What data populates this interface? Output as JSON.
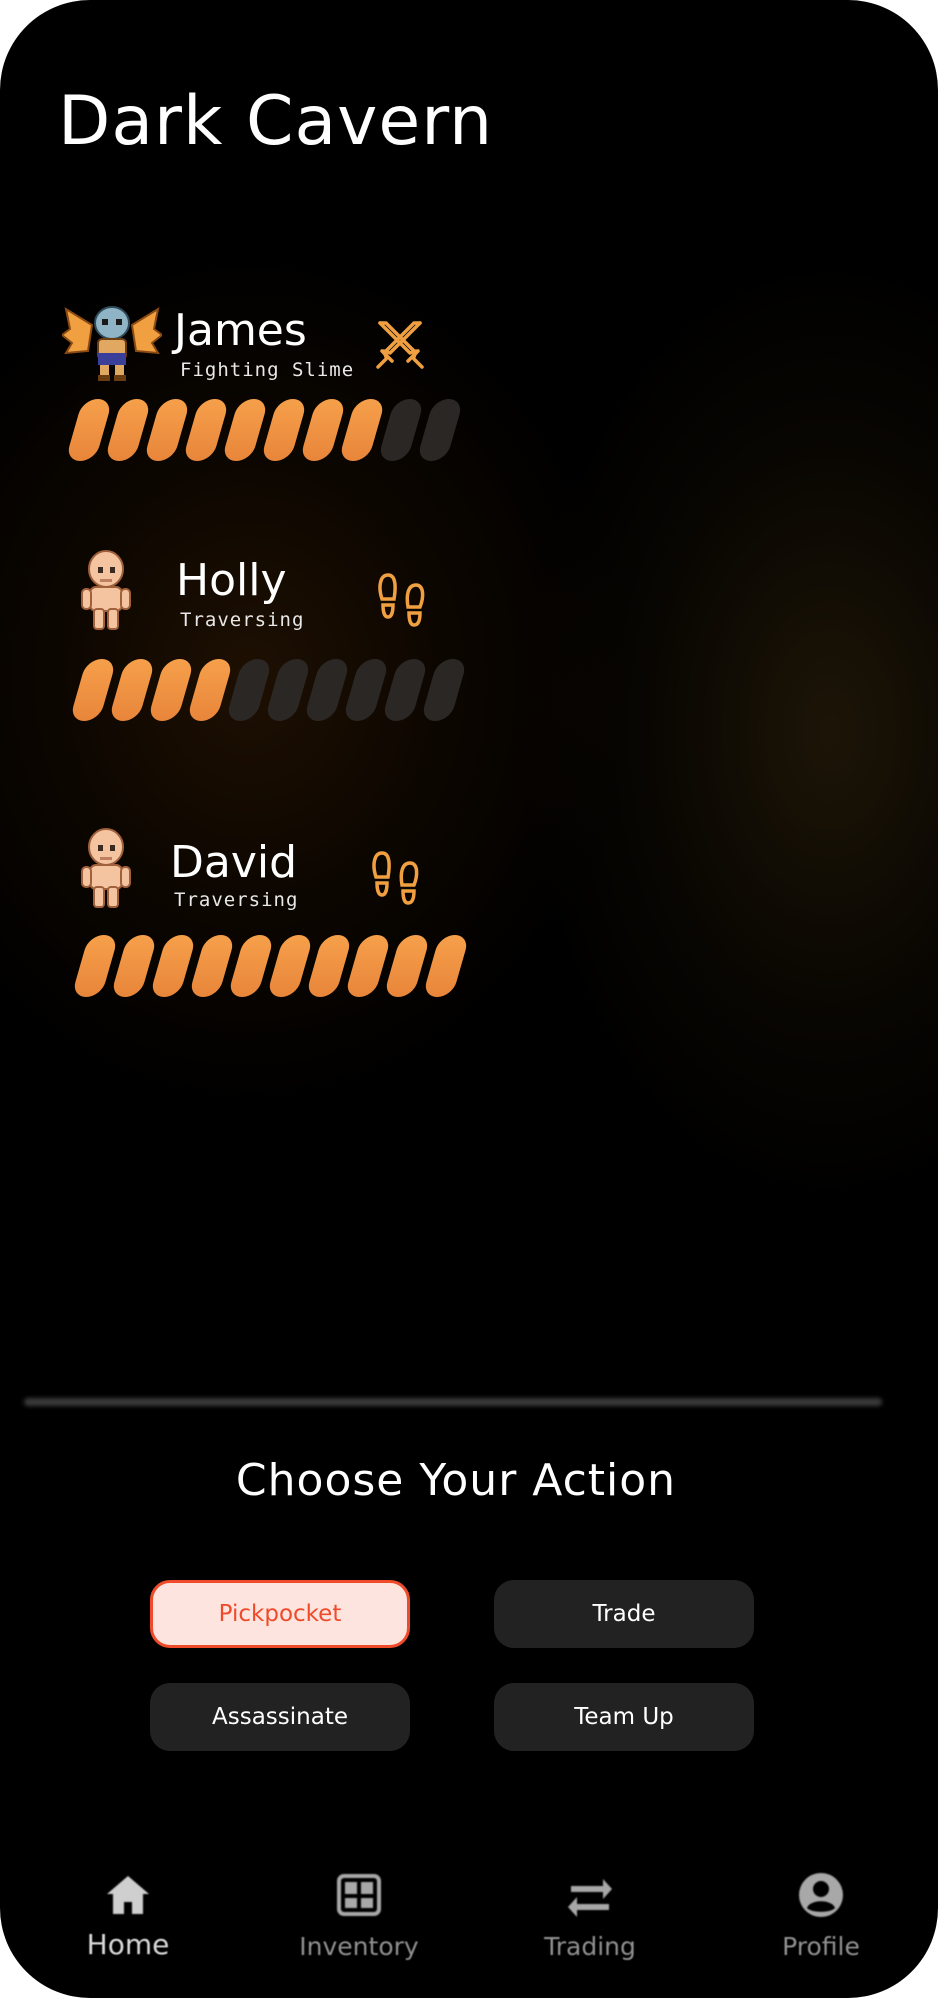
{
  "title": "Dark Cavern",
  "players": [
    {
      "name": "James",
      "status": "Fighting Slime",
      "action_icon": "crossed-swords-icon",
      "avatar": "winged-knight-avatar",
      "progress": {
        "filled": 8,
        "total": 10
      }
    },
    {
      "name": "Holly",
      "status": "Traversing",
      "action_icon": "footprints-icon",
      "avatar": "bald-human-avatar",
      "progress": {
        "filled": 4,
        "total": 10
      }
    },
    {
      "name": "David",
      "status": "Traversing",
      "action_icon": "footprints-icon",
      "avatar": "bald-human-avatar",
      "progress": {
        "filled": 10,
        "total": 10
      }
    }
  ],
  "actions": {
    "heading": "Choose Your Action",
    "buttons": [
      {
        "label": "Pickpocket",
        "selected": true
      },
      {
        "label": "Trade",
        "selected": false
      },
      {
        "label": "Assassinate",
        "selected": false
      },
      {
        "label": "Team Up",
        "selected": false
      }
    ]
  },
  "nav": {
    "items": [
      {
        "label": "Home",
        "icon": "home-icon",
        "active": true
      },
      {
        "label": "Inventory",
        "icon": "inventory-icon",
        "active": false
      },
      {
        "label": "Trading",
        "icon": "swap-arrows-icon",
        "active": false
      },
      {
        "label": "Profile",
        "icon": "profile-icon",
        "active": false
      }
    ]
  },
  "colors": {
    "accent_orange": "#f29a45",
    "empty_segment": "#2b2725",
    "selected_button_bg": "#fde4df",
    "selected_button_text": "#ef4b2a",
    "button_bg": "#222222"
  }
}
